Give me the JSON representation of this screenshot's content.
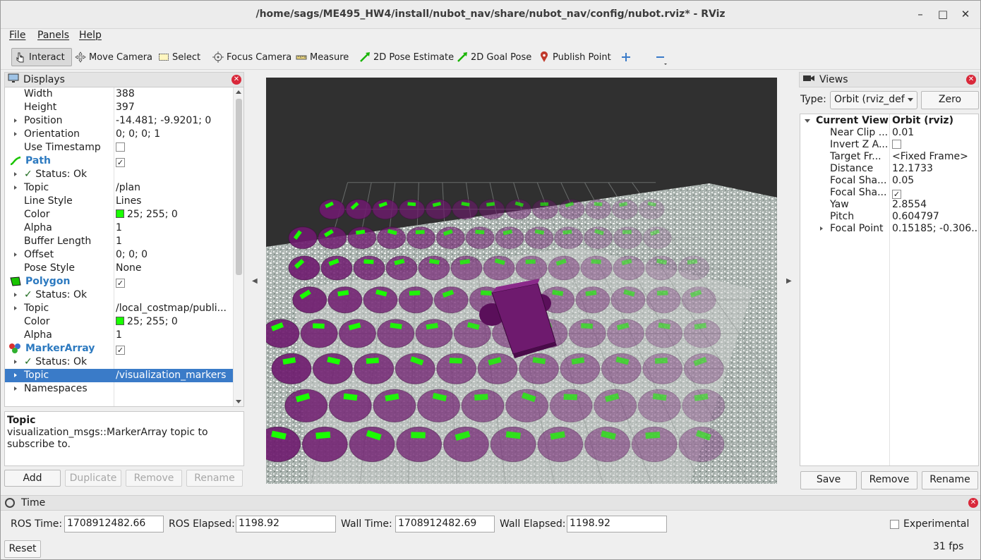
{
  "window": {
    "title": "/home/sags/ME495_HW4/install/nubot_nav/share/nubot_nav/config/nubot.rviz* - RViz"
  },
  "menu": [
    "File",
    "Panels",
    "Help"
  ],
  "toolbar": [
    {
      "label": "Interact",
      "icon": "cursor-icon"
    },
    {
      "label": "Move Camera",
      "icon": "move-icon"
    },
    {
      "label": "Select",
      "icon": "select-box-icon"
    },
    {
      "label": "Focus Camera",
      "icon": "focus-icon"
    },
    {
      "label": "Measure",
      "icon": "ruler-icon"
    },
    {
      "label": "2D Pose Estimate",
      "icon": "green-arrow-icon"
    },
    {
      "label": "2D Goal Pose",
      "icon": "green-arrow-icon"
    },
    {
      "label": "Publish Point",
      "icon": "map-pin-icon"
    }
  ],
  "displays": {
    "title": "Displays",
    "rows": [
      {
        "k": "Width",
        "v": "388"
      },
      {
        "k": "Height",
        "v": "397"
      },
      {
        "k": "Position",
        "v": "-14.481; -9.9201; 0"
      },
      {
        "k": "Orientation",
        "v": "0; 0; 0; 1"
      },
      {
        "k": "Use Timestamp",
        "v": ""
      },
      {
        "k": "Path",
        "v": ""
      },
      {
        "k": "Status: Ok",
        "v": ""
      },
      {
        "k": "Topic",
        "v": "/plan"
      },
      {
        "k": "Line Style",
        "v": "Lines"
      },
      {
        "k": "Color",
        "v": "25; 255; 0"
      },
      {
        "k": "Alpha",
        "v": "1"
      },
      {
        "k": "Buffer Length",
        "v": "1"
      },
      {
        "k": "Offset",
        "v": "0; 0; 0"
      },
      {
        "k": "Pose Style",
        "v": "None"
      },
      {
        "k": "Polygon",
        "v": ""
      },
      {
        "k": "Status: Ok",
        "v": ""
      },
      {
        "k": "Topic",
        "v": "/local_costmap/publi..."
      },
      {
        "k": "Color",
        "v": "25; 255; 0"
      },
      {
        "k": "Alpha",
        "v": "1"
      },
      {
        "k": "MarkerArray",
        "v": ""
      },
      {
        "k": "Status: Ok",
        "v": ""
      },
      {
        "k": "Topic",
        "v": "/visualization_markers"
      },
      {
        "k": "Namespaces",
        "v": ""
      }
    ],
    "desc_title": "Topic",
    "desc_text": "visualization_msgs::MarkerArray topic to subscribe to.",
    "buttons": [
      "Add",
      "Duplicate",
      "Remove",
      "Rename"
    ]
  },
  "views": {
    "title": "Views",
    "type_label": "Type:",
    "type_value": "Orbit (rviz_def",
    "zero_label": "Zero",
    "current_view": "Current View",
    "current_view_type": "Orbit (rviz)",
    "rows": [
      {
        "k": "Near Clip ...",
        "v": "0.01"
      },
      {
        "k": "Invert Z A...",
        "v": ""
      },
      {
        "k": "Target Fr...",
        "v": "<Fixed Frame>"
      },
      {
        "k": "Distance",
        "v": "12.1733"
      },
      {
        "k": "Focal Sha...",
        "v": "0.05"
      },
      {
        "k": "Focal Sha...",
        "v": ""
      },
      {
        "k": "Yaw",
        "v": "2.8554"
      },
      {
        "k": "Pitch",
        "v": "0.604797"
      },
      {
        "k": "Focal Point",
        "v": "0.15185; -0.306..."
      }
    ],
    "buttons": [
      "Save",
      "Remove",
      "Rename"
    ]
  },
  "time": {
    "title": "Time",
    "ros_time_label": "ROS Time:",
    "ros_time": "1708912482.66",
    "ros_elapsed_label": "ROS Elapsed:",
    "ros_elapsed": "1198.92",
    "wall_time_label": "Wall Time:",
    "wall_time": "1708912482.69",
    "wall_elapsed_label": "Wall Elapsed:",
    "wall_elapsed": "1198.92",
    "experimental": "Experimental",
    "reset": "Reset",
    "fps": "31 fps"
  },
  "colors": {
    "path_green": "#19ff00",
    "selection": "#3a7bc8",
    "marker_purple": "#6e1a6e",
    "close_red": "#d9283a"
  }
}
